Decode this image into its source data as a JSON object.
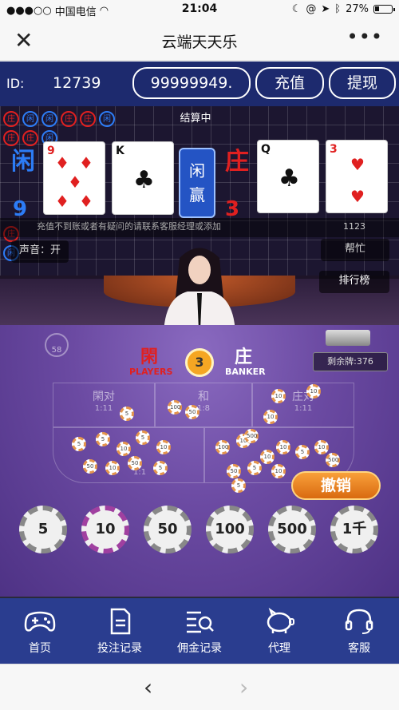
{
  "status_bar": {
    "carrier": "中国电信",
    "time": "21:04",
    "battery": "27%",
    "battery_level": 0.27
  },
  "title_bar": {
    "title": "云端天天乐"
  },
  "account": {
    "id_label": "ID:",
    "id_value": "12739",
    "balance": "99999949.",
    "recharge_label": "充值",
    "withdraw_label": "提现"
  },
  "result": {
    "status": "结算中",
    "player_label": "闲",
    "player_score": "9",
    "banker_label": "庄",
    "banker_score": "3",
    "winner_label_1": "闲",
    "winner_label_2": "赢",
    "player_cards": [
      {
        "rank": "9",
        "suit": "♦"
      },
      {
        "rank": "K",
        "suit": "♣"
      }
    ],
    "banker_cards": [
      {
        "rank": "Q",
        "suit": "♣"
      },
      {
        "rank": "3",
        "suit": "♥"
      }
    ]
  },
  "notice": {
    "text": "充值不到账或者有疑问的请联系客服经理或添加",
    "count": "1123"
  },
  "side_buttons": {
    "sound": "声音：开",
    "help": "帮忙",
    "ranking": "排行榜"
  },
  "table": {
    "online_count": "58",
    "player_cn": "閑",
    "player_en": "PLAYERS",
    "banker_cn": "庄",
    "banker_en": "BANKER",
    "countdown": "3",
    "deck_remaining": "剩余牌:376",
    "player_pair": "閑对",
    "player_pair_odds": "1:11",
    "tie": "和",
    "tie_odds": "1:8",
    "banker_pair": "庄对",
    "banker_pair_odds": "1:11",
    "player_odds": "1:1",
    "undo_label": "撤销"
  },
  "chips": [
    "5",
    "10",
    "50",
    "100",
    "500",
    "1千"
  ],
  "bottom_nav": [
    {
      "label": "首页",
      "icon": "gamepad-icon"
    },
    {
      "label": "投注记录",
      "icon": "document-icon"
    },
    {
      "label": "佣金记录",
      "icon": "search-list-icon"
    },
    {
      "label": "代理",
      "icon": "piggy-bank-icon"
    },
    {
      "label": "客服",
      "icon": "headset-icon"
    }
  ],
  "colors": {
    "nav_bg": "#2a3d8f",
    "id_bar_bg": "#1d2a6e",
    "player_blue": "#2c7cf6",
    "banker_red": "#e02020",
    "undo_orange": "#f08a1e"
  }
}
